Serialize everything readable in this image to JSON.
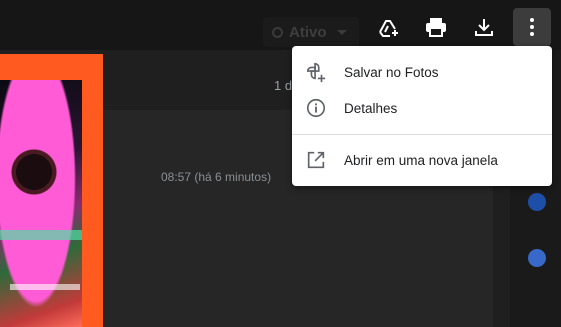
{
  "toolbar": {
    "status_label": "Ativo",
    "buttons": [
      {
        "icon": "add-to-drive-icon"
      },
      {
        "icon": "print-icon"
      },
      {
        "icon": "download-icon"
      },
      {
        "icon": "more-vert-icon"
      }
    ]
  },
  "message": {
    "header_text": "1 d",
    "timestamp": "08:57 (há 6 minutos)"
  },
  "menu": {
    "items": [
      {
        "label": "Salvar no Fotos",
        "icon": "photos-add-icon"
      },
      {
        "label": "Detalhes",
        "icon": "info-icon"
      },
      {
        "label": "Abrir em uma nova janela",
        "icon": "open-in-new-icon"
      }
    ]
  },
  "colors": {
    "menu_bg": "#ffffff",
    "toolbar_bg": "#161616",
    "accent_image_border": "#ff5a1f"
  }
}
